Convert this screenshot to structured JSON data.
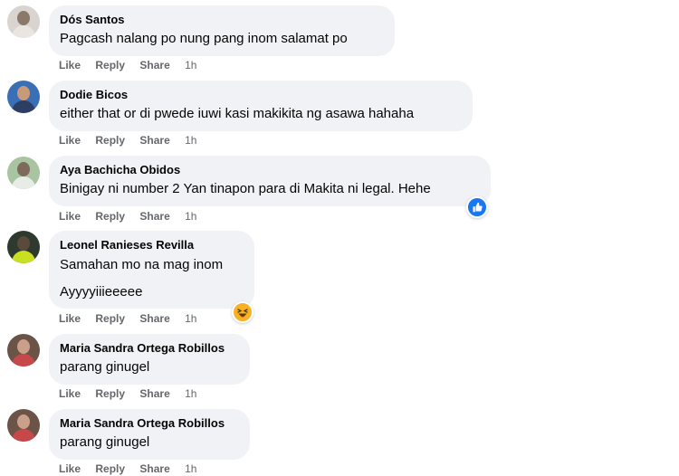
{
  "comments": [
    {
      "author": "Dós Santos",
      "text": "Pagcash nalang po nung pang inom salamat po",
      "text2": "",
      "like": "Like",
      "reply": "Reply",
      "share": "Share",
      "time": "1h"
    },
    {
      "author": "Dodie Bicos",
      "text": "either that or di pwede iuwi kasi makikita ng asawa hahaha",
      "text2": "",
      "like": "Like",
      "reply": "Reply",
      "share": "Share",
      "time": "1h"
    },
    {
      "author": "Aya Bachicha Obidos",
      "text": "Binigay ni number 2 Yan tinapon para di Makita ni legal. Hehe",
      "text2": "",
      "like": "Like",
      "reply": "Reply",
      "share": "Share",
      "time": "1h",
      "reaction": "like-reaction-icon"
    },
    {
      "author": "Leonel Ranieses Revilla",
      "text": "Samahan mo na mag inom",
      "text2": "Ayyyyiiieeeee",
      "like": "Like",
      "reply": "Reply",
      "share": "Share",
      "time": "1h",
      "reaction": "haha-reaction-icon"
    },
    {
      "author": "Maria Sandra Ortega Robillos",
      "text": "parang ginugel",
      "text2": "",
      "like": "Like",
      "reply": "Reply",
      "share": "Share",
      "time": "1h"
    },
    {
      "author": "Maria Sandra Ortega Robillos",
      "text": "parang ginugel",
      "text2": "",
      "like": "Like",
      "reply": "Reply",
      "share": "Share",
      "time": "1h"
    }
  ],
  "colors": {
    "bubble": "#f0f2f5",
    "action_text": "#65676b",
    "like_blue": "#1877f2",
    "haha_yellow": "#f7b125"
  }
}
